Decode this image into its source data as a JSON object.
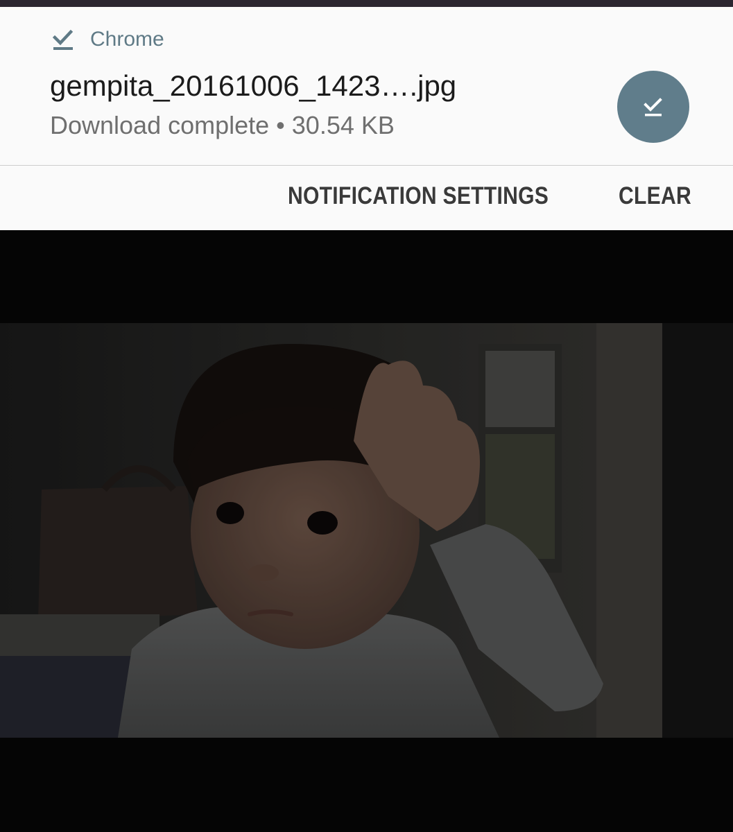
{
  "notification": {
    "app_name": "Chrome",
    "app_icon": "download-done-icon",
    "file_name": "gempita_20161006_1423….jpg",
    "status": "Download complete • 30.54 KB",
    "action_icon": "download-done-icon",
    "accent_color": "#607d8b"
  },
  "actions": {
    "settings_label": "NOTIFICATION SETTINGS",
    "clear_label": "CLEAR"
  },
  "photo": {
    "subject": "child-photo"
  }
}
